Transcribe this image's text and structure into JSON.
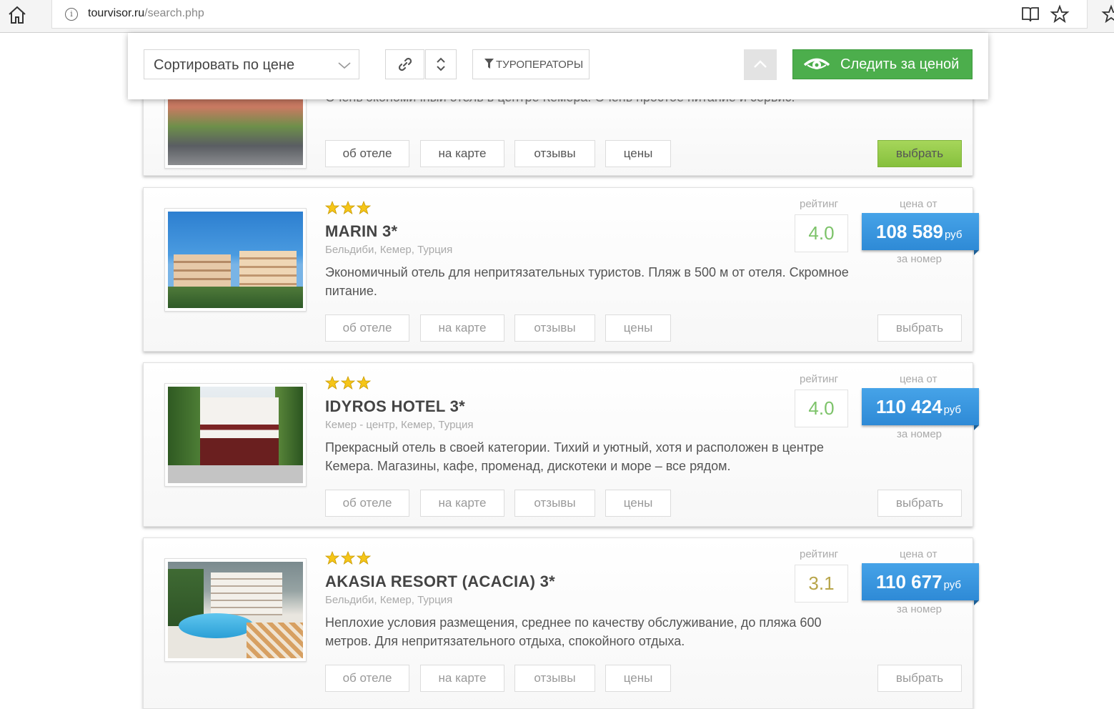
{
  "browser": {
    "url_host": "tourvisor.ru",
    "url_path": "/search.php"
  },
  "toolbar": {
    "sort_label": "Сортировать по цене",
    "operators_label": "ТУРОПЕРАТОРЫ",
    "watch_label": "Следить за ценой"
  },
  "labels": {
    "rating": "рейтинг",
    "price_from": "цена от",
    "per_room": "за номер",
    "currency": "руб",
    "about": "об отеле",
    "map": "на карте",
    "reviews": "отзывы",
    "prices": "цены",
    "choose": "выбрать"
  },
  "hotels": [
    {
      "name": "",
      "desc": "Очень экономичный отель в центре Кемера. Очень простое питание и сервис."
    },
    {
      "name": "MARIN 3*",
      "stars": 3,
      "location": "Бельдиби, Кемер, Турция",
      "desc": "Экономичный отель для непритязательных туристов. Пляж в 500 м от отеля. Скромное питание.",
      "rating": "4.0",
      "rating_color": "#7dc36a",
      "price": "108 589"
    },
    {
      "name": "IDYROS HOTEL 3*",
      "stars": 3,
      "location": "Кемер - центр, Кемер, Турция",
      "desc": "Прекрасный отель в своей категории. Тихий и уютный, хотя и расположен в центре Кемера. Магазины, кафе, променад, дискотеки и море – все рядом.",
      "rating": "4.0",
      "rating_color": "#7dc36a",
      "price": "110 424"
    },
    {
      "name": "AKASIA RESORT (ACACIA) 3*",
      "stars": 3,
      "location": "Бельдиби, Кемер, Турция",
      "desc": "Неплохие условия размещения, среднее по качеству обслуживание, до пляжа 600 метров. Для непритязательного отдыха, спокойного отдыха.",
      "rating": "3.1",
      "rating_color": "#b8a54a",
      "price": "110 677"
    }
  ],
  "colors": {
    "accent_blue": "#2e8ad6",
    "green_button": "#4cae4c",
    "choose_green": "#86c03d"
  }
}
